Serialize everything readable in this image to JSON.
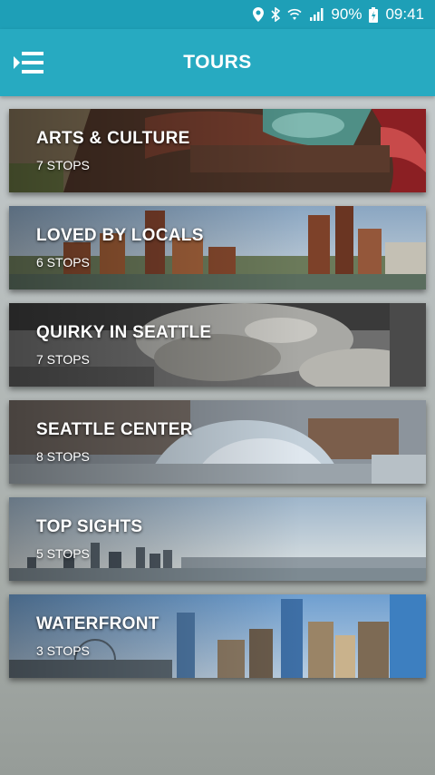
{
  "status_bar": {
    "battery": "90%",
    "time": "09:41",
    "icons": [
      "location-icon",
      "bluetooth-icon",
      "wifi-icon",
      "signal-icon",
      "battery-icon"
    ]
  },
  "app_bar": {
    "title": "TOURS",
    "menu_icon": "menu-icon",
    "color": "#27aac1"
  },
  "tours": [
    {
      "title": "ARTS & CULTURE",
      "stops": "7 STOPS"
    },
    {
      "title": "LOVED BY LOCALS",
      "stops": "6 STOPS"
    },
    {
      "title": "QUIRKY IN SEATTLE",
      "stops": "7 STOPS"
    },
    {
      "title": "SEATTLE CENTER",
      "stops": "8 STOPS"
    },
    {
      "title": "TOP SIGHTS",
      "stops": "5 STOPS"
    },
    {
      "title": "WATERFRONT",
      "stops": "3 STOPS"
    }
  ]
}
